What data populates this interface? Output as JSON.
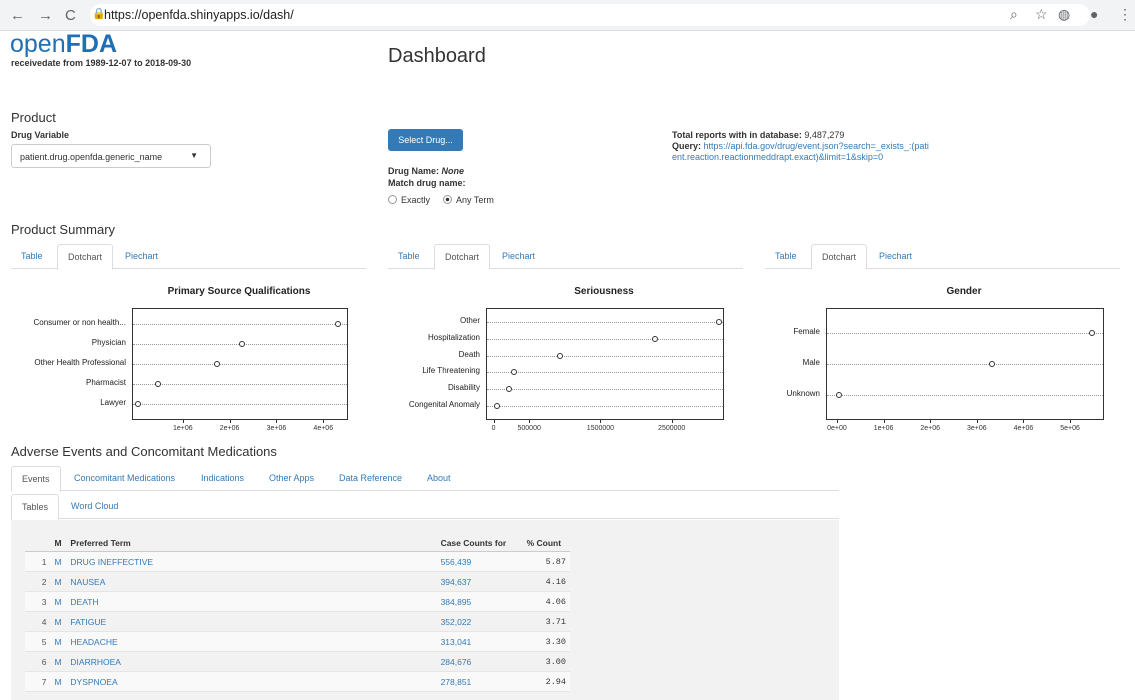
{
  "browser": {
    "url": "https://openfda.shinyapps.io/dash/",
    "back": "←",
    "forward": "→",
    "reload": "C",
    "icons": [
      "zoom-icon",
      "star-icon",
      "extension-icon",
      "profile-icon",
      "menu-icon"
    ]
  },
  "header": {
    "logo_light": "open",
    "logo_bold": "FDA",
    "subtitle": "receivedate from 1989-12-07 to 2018-09-30",
    "title": "Dashboard"
  },
  "product": {
    "heading": "Product",
    "drug_variable_label": "Drug Variable",
    "drug_variable_value": "patient.drug.openfda.generic_name",
    "select_button": "Select Drug...",
    "drug_name_label": "Drug Name:",
    "drug_name_value": "None",
    "match_label": "Match drug name:",
    "match_options": [
      "Exactly",
      "Any Term"
    ],
    "match_selected": "Any Term",
    "total_reports_label": "Total reports with in database:",
    "total_reports_value": "9,487,279",
    "query_label": "Query:",
    "query_value": "https://api.fda.gov/drug/event.json?search=_exists_:(patient.reaction.reactionmeddrapt.exact)&limit=1&skip=0"
  },
  "summary": {
    "heading": "Product Summary",
    "tabs": [
      "Table",
      "Dotchart",
      "Piechart"
    ],
    "active_tab": "Dotchart"
  },
  "chart_data": [
    {
      "type": "scatter",
      "title": "Primary Source Qualifications",
      "categories": [
        "Consumer or non health...",
        "Physician",
        "Other Health Professional",
        "Pharmacist",
        "Lawyer"
      ],
      "values": [
        4300000,
        2250000,
        1700000,
        450000,
        30000
      ],
      "xticks": [
        "1e+06",
        "2e+06",
        "3e+06",
        "4e+06"
      ],
      "tick_values": [
        1000000,
        2000000,
        3000000,
        4000000
      ],
      "xlim": [
        0,
        4400000
      ]
    },
    {
      "type": "scatter",
      "title": "Seriousness",
      "categories": [
        "Other",
        "Hospitalization",
        "Death",
        "Life Threatening",
        "Disability",
        "Congenital Anomaly"
      ],
      "values": [
        3150000,
        2250000,
        920000,
        270000,
        200000,
        30000
      ],
      "xticks": [
        "0",
        "500000",
        "1500000",
        "2500000"
      ],
      "tick_values": [
        0,
        500000,
        1500000,
        2500000
      ],
      "xlim": [
        -50000,
        3150000
      ]
    },
    {
      "type": "scatter",
      "title": "Gender",
      "categories": [
        "Female",
        "Male",
        "Unknown"
      ],
      "values": [
        5450000,
        3300000,
        30000
      ],
      "xticks": [
        "0e+00",
        "1e+06",
        "2e+06",
        "3e+06",
        "4e+06",
        "5e+06"
      ],
      "tick_values": [
        0,
        1000000,
        2000000,
        3000000,
        4000000,
        5000000
      ],
      "xlim": [
        -150000,
        5600000
      ]
    }
  ],
  "adverse": {
    "heading": "Adverse Events and Concomitant Medications",
    "tabs": [
      "Events",
      "Concomitant Medications",
      "Indications",
      "Other Apps",
      "Data Reference",
      "About"
    ],
    "active_tab": "Events",
    "subtabs": [
      "Tables",
      "Word Cloud"
    ],
    "active_subtab": "Tables",
    "table": {
      "columns": [
        "M",
        "Preferred Term",
        "Case Counts for",
        "% Count"
      ],
      "rows": [
        {
          "i": "1",
          "m": "M",
          "term": "DRUG INEFFECTIVE",
          "count": "556,439",
          "pct": "5.87"
        },
        {
          "i": "2",
          "m": "M",
          "term": "NAUSEA",
          "count": "394,637",
          "pct": "4.16"
        },
        {
          "i": "3",
          "m": "M",
          "term": "DEATH",
          "count": "384,895",
          "pct": "4.06"
        },
        {
          "i": "4",
          "m": "M",
          "term": "FATIGUE",
          "count": "352,022",
          "pct": "3.71"
        },
        {
          "i": "5",
          "m": "M",
          "term": "HEADACHE",
          "count": "313,041",
          "pct": "3.30"
        },
        {
          "i": "6",
          "m": "M",
          "term": "DIARRHOEA",
          "count": "284,676",
          "pct": "3.00"
        },
        {
          "i": "7",
          "m": "M",
          "term": "DYSPNOEA",
          "count": "278,851",
          "pct": "2.94"
        }
      ]
    }
  },
  "colors": {
    "link": "#337ab7",
    "button": "#337ab7",
    "logo": "#1f6fb4"
  }
}
